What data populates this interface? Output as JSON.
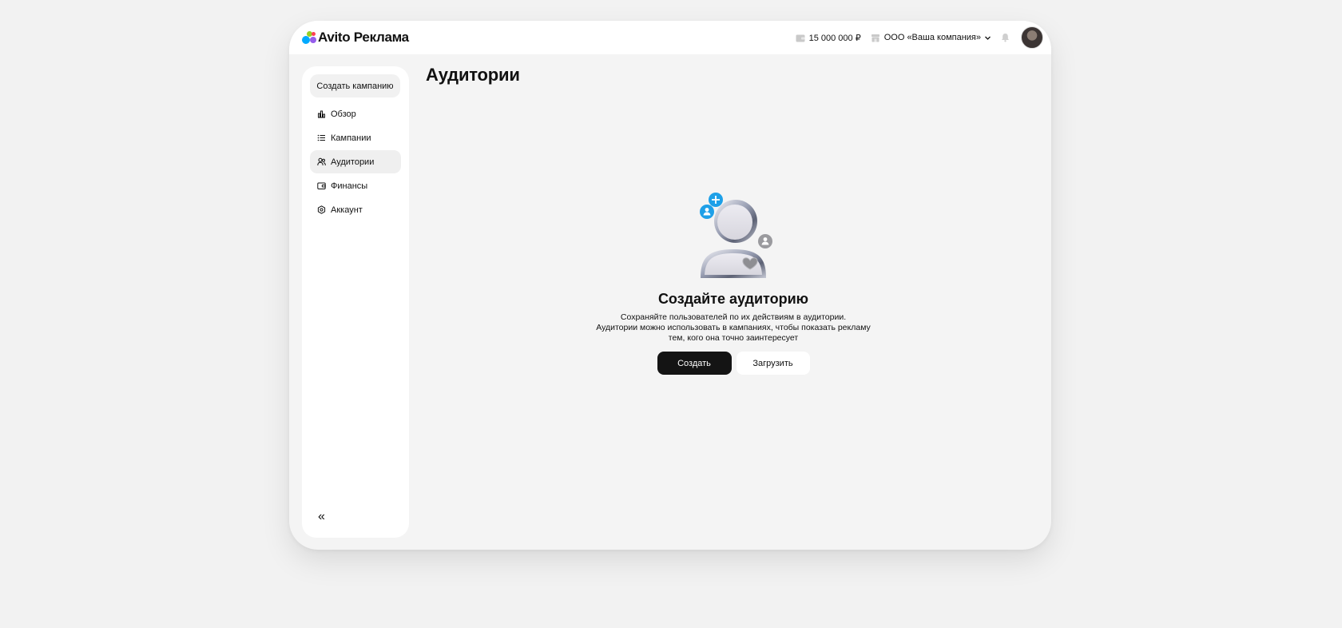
{
  "header": {
    "logo_text": "Avito Реклама",
    "balance": "15 000 000 ₽",
    "company": "ООО «Ваша компания»",
    "logo_colors": [
      "#00AAFF",
      "#97CF26",
      "#FF4053",
      "#965EEB"
    ]
  },
  "sidebar": {
    "create_label": "Создать кампанию",
    "items": [
      {
        "label": "Обзор",
        "icon": "chart-bars-icon",
        "active": false
      },
      {
        "label": "Кампании",
        "icon": "list-icon",
        "active": false
      },
      {
        "label": "Аудитории",
        "icon": "users-icon",
        "active": true
      },
      {
        "label": "Финансы",
        "icon": "wallet-icon",
        "active": false
      },
      {
        "label": "Аккаунт",
        "icon": "gear-icon",
        "active": false
      }
    ],
    "collapse_symbol": "«"
  },
  "main": {
    "title": "Аудитории",
    "empty": {
      "title": "Создайте аудиторию",
      "description_lines": [
        "Сохраняйте пользователей по их действиям в аудитории.",
        "Аудитории можно использовать в кампаниях, чтобы показать рекламу",
        "тем, кого она точно заинтересует"
      ],
      "primary_label": "Создать",
      "secondary_label": "Загрузить"
    }
  },
  "colors": {
    "accent_blue": "#1EA0E8",
    "dark_button": "#141414",
    "page_bg": "#F4F4F4"
  }
}
